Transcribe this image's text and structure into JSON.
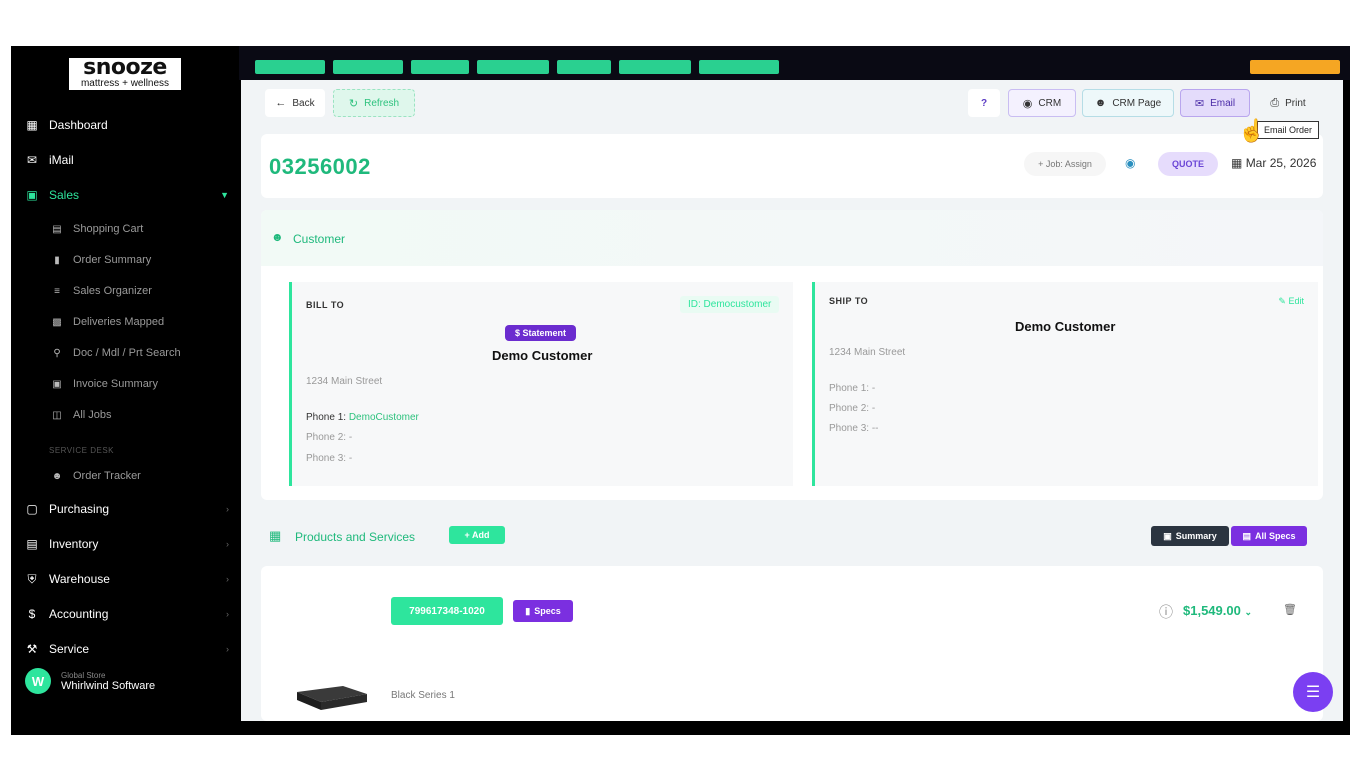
{
  "brand": {
    "name": "snooze",
    "tagline": "mattress + wellness"
  },
  "sidebar": {
    "items": [
      {
        "label": "Dashboard",
        "icon": "dashboard-icon"
      },
      {
        "label": "iMail",
        "icon": "mail-icon"
      },
      {
        "label": "Sales",
        "icon": "sales-icon",
        "active": true
      },
      {
        "label": "Purchasing",
        "icon": "bag-icon"
      },
      {
        "label": "Inventory",
        "icon": "inventory-icon"
      },
      {
        "label": "Warehouse",
        "icon": "warehouse-icon"
      },
      {
        "label": "Accounting",
        "icon": "dollar-icon"
      },
      {
        "label": "Service",
        "icon": "wrench-icon"
      }
    ],
    "sales_sub": [
      {
        "label": "Shopping Cart",
        "icon": "cart-icon"
      },
      {
        "label": "Order Summary",
        "icon": "document-icon"
      },
      {
        "label": "Sales Organizer",
        "icon": "list-icon"
      },
      {
        "label": "Deliveries Mapped",
        "icon": "map-icon"
      },
      {
        "label": "Doc / Mdl / Prt Search",
        "icon": "search-icon"
      },
      {
        "label": "Invoice Summary",
        "icon": "invoice-icon"
      },
      {
        "label": "All Jobs",
        "icon": "jobs-icon"
      }
    ],
    "section_caption": "SERVICE DESK",
    "tracker": {
      "label": "Order Tracker",
      "icon": "people-icon"
    },
    "user": {
      "initial": "W",
      "role": "Global Store",
      "org": "Whirlwind Software"
    }
  },
  "toolbar": {
    "back": "Back",
    "refresh": "Refresh",
    "crm": "CRM",
    "crm_page": "CRM Page",
    "email": "Email",
    "print": "Print",
    "tooltip": "Email Order"
  },
  "order": {
    "number": "03256002",
    "assign": "+ Job: Assign",
    "status": "QUOTE",
    "date": "Mar 25, 2026"
  },
  "customer": {
    "section_title": "Customer",
    "bill": {
      "heading": "BILL TO",
      "id": "ID: Democustomer",
      "statement": "$ Statement",
      "name": "Demo Customer",
      "street": "1234 Main Street",
      "phone1_label": "Phone 1:",
      "phone1": "DemoCustomer",
      "phone2": "Phone 2: -",
      "phone3": "Phone 3: -"
    },
    "ship": {
      "heading": "SHIP TO",
      "edit": "Edit",
      "name": "Demo Customer",
      "street": "1234 Main Street",
      "phone1": "Phone 1: -",
      "phone2": "Phone 2: -",
      "phone3": "Phone 3: --"
    }
  },
  "products": {
    "section_title": "Products and Services",
    "add": "+ Add",
    "summary": "Summary",
    "all_specs": "All Specs",
    "items": [
      {
        "sku": "799617348-1020",
        "specs": "Specs",
        "name": "Black Series 1",
        "price": "$1,549.00"
      }
    ]
  },
  "colors": {
    "accent": "#2ee59d",
    "purple": "#7b2fe0",
    "sidebar_bg": "#000000"
  }
}
